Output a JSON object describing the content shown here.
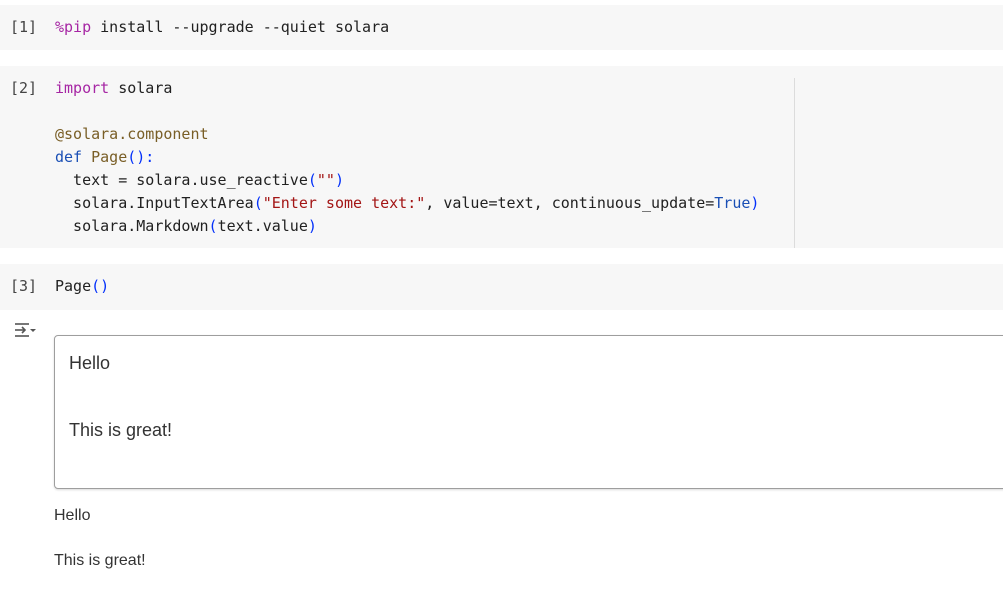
{
  "cells": [
    {
      "count": "[1]",
      "lines": [
        [
          {
            "t": "%pip",
            "c": "kw-magic"
          },
          {
            "t": " install --upgrade --quiet solara",
            "c": "plain"
          }
        ]
      ]
    },
    {
      "count": "[2]",
      "lines": [
        [
          {
            "t": "import",
            "c": "kw"
          },
          {
            "t": " solara",
            "c": "plain"
          }
        ],
        [
          {
            "t": "",
            "c": "plain"
          }
        ],
        [
          {
            "t": "@solara.component",
            "c": "decorator"
          }
        ],
        [
          {
            "t": "def",
            "c": "kw-def"
          },
          {
            "t": " ",
            "c": "plain"
          },
          {
            "t": "Page",
            "c": "fn-name"
          },
          {
            "t": "():",
            "c": "paren"
          }
        ],
        [
          {
            "t": "  text = solara.use_reactive",
            "c": "plain"
          },
          {
            "t": "(",
            "c": "paren"
          },
          {
            "t": "\"\"",
            "c": "string"
          },
          {
            "t": ")",
            "c": "paren"
          }
        ],
        [
          {
            "t": "  solara.InputTextArea",
            "c": "plain"
          },
          {
            "t": "(",
            "c": "paren"
          },
          {
            "t": "\"Enter some text:\"",
            "c": "string"
          },
          {
            "t": ", value=text, continuous_update=",
            "c": "plain"
          },
          {
            "t": "True",
            "c": "bool"
          },
          {
            "t": ")",
            "c": "paren"
          }
        ],
        [
          {
            "t": "  solara.Markdown",
            "c": "plain"
          },
          {
            "t": "(",
            "c": "paren"
          },
          {
            "t": "text.value",
            "c": "plain"
          },
          {
            "t": ")",
            "c": "paren"
          }
        ]
      ]
    },
    {
      "count": "[3]",
      "lines": [
        [
          {
            "t": "Page",
            "c": "plain"
          },
          {
            "t": "()",
            "c": "paren"
          }
        ]
      ]
    }
  ],
  "output": {
    "textarea_value_line1": "Hello",
    "textarea_value_line2": "This is great!",
    "markdown_line1": "Hello",
    "markdown_line2": "This is great!"
  }
}
